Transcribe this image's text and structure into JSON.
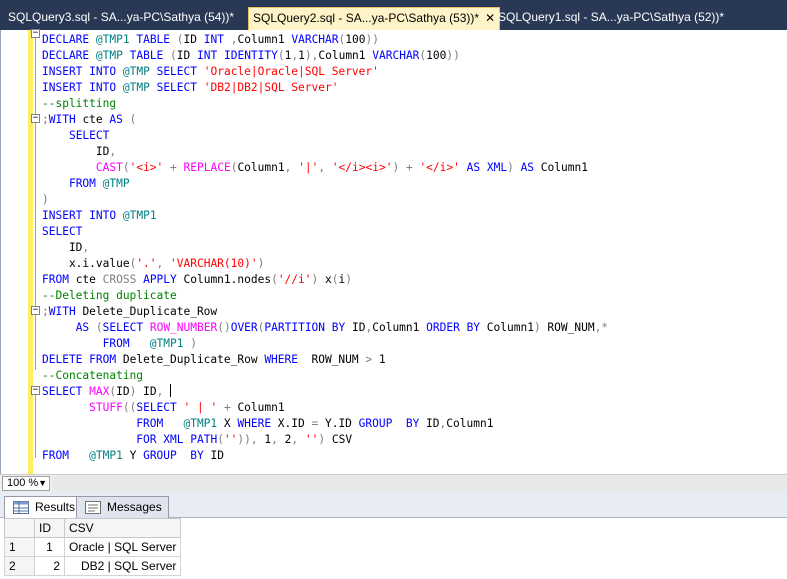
{
  "tabs": [
    {
      "label": "SQLQuery3.sql - SA...ya-PC\\Sathya (54))*",
      "active": false
    },
    {
      "label": "SQLQuery2.sql - SA...ya-PC\\Sathya (53))*",
      "active": true
    },
    {
      "label": "SQLQuery1.sql - SA...ya-PC\\Sathya (52))*",
      "active": false
    }
  ],
  "tab_close_glyph": "✕",
  "code_lines": [
    "DECLARE @TMP1 TABLE (ID INT ,Column1 VARCHAR(100))",
    "DECLARE @TMP TABLE (ID INT IDENTITY(1,1),Column1 VARCHAR(100))",
    "INSERT INTO @TMP SELECT 'Oracle|Oracle|SQL Server'",
    "INSERT INTO @TMP SELECT 'DB2|DB2|SQL Server'",
    "--splitting",
    ";WITH cte AS (",
    "    SELECT",
    "        ID,",
    "        CAST('<i>' + REPLACE(Column1, '|', '</i><i>') + '</i>' AS XML) AS Column1",
    "    FROM @TMP",
    ")",
    "INSERT INTO @TMP1",
    "SELECT",
    "    ID,",
    "    x.i.value('.', 'VARCHAR(10)')",
    "FROM cte CROSS APPLY Column1.nodes('//i') x(i)",
    "--Deleting duplicate",
    ";WITH Delete_Duplicate_Row",
    "     AS (SELECT ROW_NUMBER()OVER(PARTITION BY ID,Column1 ORDER BY Column1) ROW_NUM,*",
    "         FROM   @TMP1 )",
    "DELETE FROM Delete_Duplicate_Row WHERE  ROW_NUM > 1",
    "--Concatenating",
    "SELECT MAX(ID) ID, ",
    "       STUFF((SELECT ' | ' + Column1",
    "              FROM   @TMP1 X WHERE X.ID = Y.ID GROUP  BY ID,Column1",
    "              FOR XML PATH('')), 1, 2, '') CSV",
    "FROM   @TMP1 Y GROUP  BY ID"
  ],
  "zoom": {
    "value": "100 %",
    "arrow": "▼"
  },
  "results_tabs": [
    {
      "label": "Results",
      "icon": "grid-icon",
      "active": true
    },
    {
      "label": "Messages",
      "icon": "messages-icon",
      "active": false
    }
  ],
  "grid": {
    "columns": [
      "ID",
      "CSV"
    ],
    "rows": [
      {
        "rownum": "1",
        "id": "1",
        "csv": "Oracle | SQL Server"
      },
      {
        "rownum": "2",
        "id": "2",
        "csv": "DB2 | SQL Server"
      }
    ]
  },
  "colors": {
    "keyword": "#0000ff",
    "function": "#ff00ff",
    "string": "#ff0000",
    "comment": "#008000",
    "operator": "#808080",
    "tabstrip": "#293955",
    "active_tab": "#fff4c8",
    "change_bar": "#ffee62"
  }
}
